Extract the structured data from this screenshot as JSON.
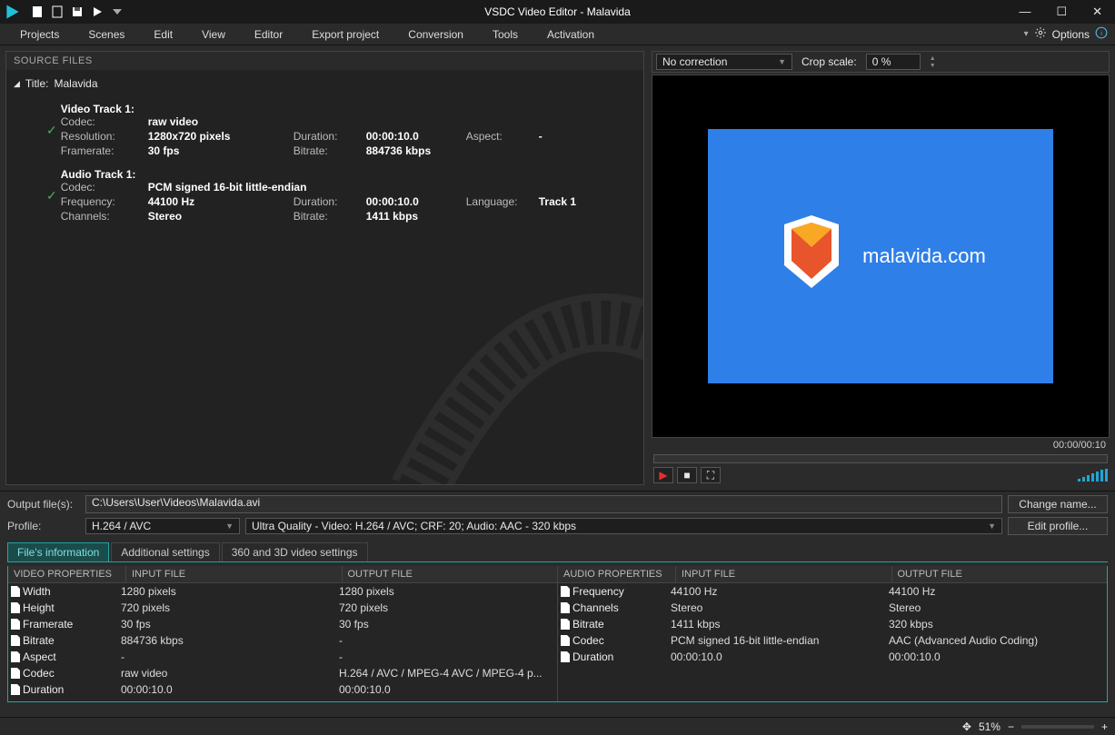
{
  "titlebar": {
    "title": "VSDC Video Editor - Malavida"
  },
  "menu": {
    "items": [
      "Projects",
      "Scenes",
      "Edit",
      "View",
      "Editor",
      "Export project",
      "Conversion",
      "Tools",
      "Activation"
    ],
    "options": "Options"
  },
  "source": {
    "header": "SOURCE FILES",
    "title_label": "Title:",
    "title_value": "Malavida",
    "video_track": {
      "head": "Video Track 1:",
      "codec_lbl": "Codec:",
      "codec": "raw video",
      "resolution_lbl": "Resolution:",
      "resolution": "1280x720 pixels",
      "duration_lbl": "Duration:",
      "duration": "00:00:10.0",
      "aspect_lbl": "Aspect:",
      "aspect": "-",
      "framerate_lbl": "Framerate:",
      "framerate": "30 fps",
      "bitrate_lbl": "Bitrate:",
      "bitrate": "884736 kbps"
    },
    "audio_track": {
      "head": "Audio Track 1:",
      "codec_lbl": "Codec:",
      "codec": "PCM signed 16-bit little-endian",
      "frequency_lbl": "Frequency:",
      "frequency": "44100 Hz",
      "duration_lbl": "Duration:",
      "duration": "00:00:10.0",
      "language_lbl": "Language:",
      "language": "Track 1",
      "channels_lbl": "Channels:",
      "channels": "Stereo",
      "bitrate_lbl": "Bitrate:",
      "bitrate": "1411 kbps"
    }
  },
  "preview": {
    "correction": "No correction",
    "crop_label": "Crop scale:",
    "crop_value": "0 %",
    "logo_text": "malavida.com",
    "time": "00:00/00:10"
  },
  "output": {
    "files_lbl": "Output file(s):",
    "path": "C:\\Users\\User\\Videos\\Malavida.avi",
    "change_name": "Change name...",
    "profile_lbl": "Profile:",
    "profile_codec": "H.264 / AVC",
    "profile_desc": "Ultra Quality - Video: H.264 / AVC; CRF: 20; Audio: AAC - 320 kbps",
    "edit_profile": "Edit profile..."
  },
  "tabs": {
    "t1": "File's information",
    "t2": "Additional settings",
    "t3": "360 and 3D video settings"
  },
  "vprops": {
    "h1": "VIDEO PROPERTIES",
    "h2": "INPUT FILE",
    "h3": "OUTPUT FILE",
    "rows": [
      {
        "n": "Width",
        "i": "1280 pixels",
        "o": "1280 pixels"
      },
      {
        "n": "Height",
        "i": "720 pixels",
        "o": "720 pixels"
      },
      {
        "n": "Framerate",
        "i": "30 fps",
        "o": "30 fps"
      },
      {
        "n": "Bitrate",
        "i": "884736 kbps",
        "o": "-"
      },
      {
        "n": "Aspect",
        "i": "-",
        "o": "-"
      },
      {
        "n": "Codec",
        "i": "raw video",
        "o": "H.264 / AVC / MPEG-4 AVC / MPEG-4 p..."
      },
      {
        "n": "Duration",
        "i": "00:00:10.0",
        "o": "00:00:10.0"
      }
    ]
  },
  "aprops": {
    "h1": "AUDIO PROPERTIES",
    "h2": "INPUT FILE",
    "h3": "OUTPUT FILE",
    "rows": [
      {
        "n": "Frequency",
        "i": "44100 Hz",
        "o": "44100 Hz"
      },
      {
        "n": "Channels",
        "i": "Stereo",
        "o": "Stereo"
      },
      {
        "n": "Bitrate",
        "i": "1411 kbps",
        "o": "320 kbps"
      },
      {
        "n": "Codec",
        "i": "PCM signed 16-bit little-endian",
        "o": "AAC (Advanced Audio Coding)"
      },
      {
        "n": "Duration",
        "i": "00:00:10.0",
        "o": "00:00:10.0"
      }
    ]
  },
  "status": {
    "zoom": "51%"
  }
}
